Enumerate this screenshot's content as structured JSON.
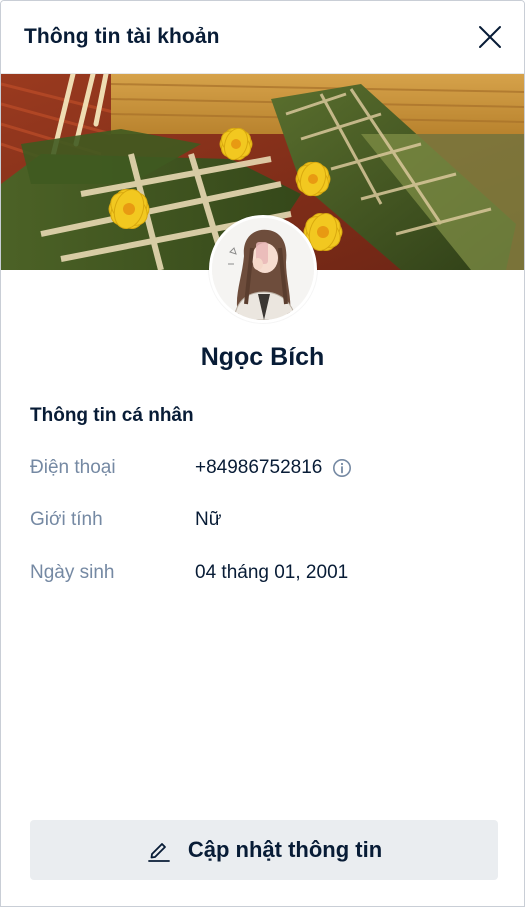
{
  "header": {
    "title": "Thông tin tài khoản",
    "close_icon": "close-icon"
  },
  "profile": {
    "display_name": "Ngọc Bích"
  },
  "personal_info": {
    "section_title": "Thông tin cá nhân",
    "rows": [
      {
        "label": "Điện thoại",
        "value": "+84986752816",
        "icon": "info-circle-icon"
      },
      {
        "label": "Giới tính",
        "value": "Nữ"
      },
      {
        "label": "Ngày sinh",
        "value": "04 tháng 01, 2001"
      }
    ]
  },
  "footer": {
    "update_label": "Cập nhật thông tin",
    "update_icon": "pencil-edit-icon"
  },
  "colors": {
    "primary_text": "#081c36",
    "secondary_text": "#7589a3",
    "button_bg": "#eaedf0",
    "divider": "#e6e8ea"
  }
}
